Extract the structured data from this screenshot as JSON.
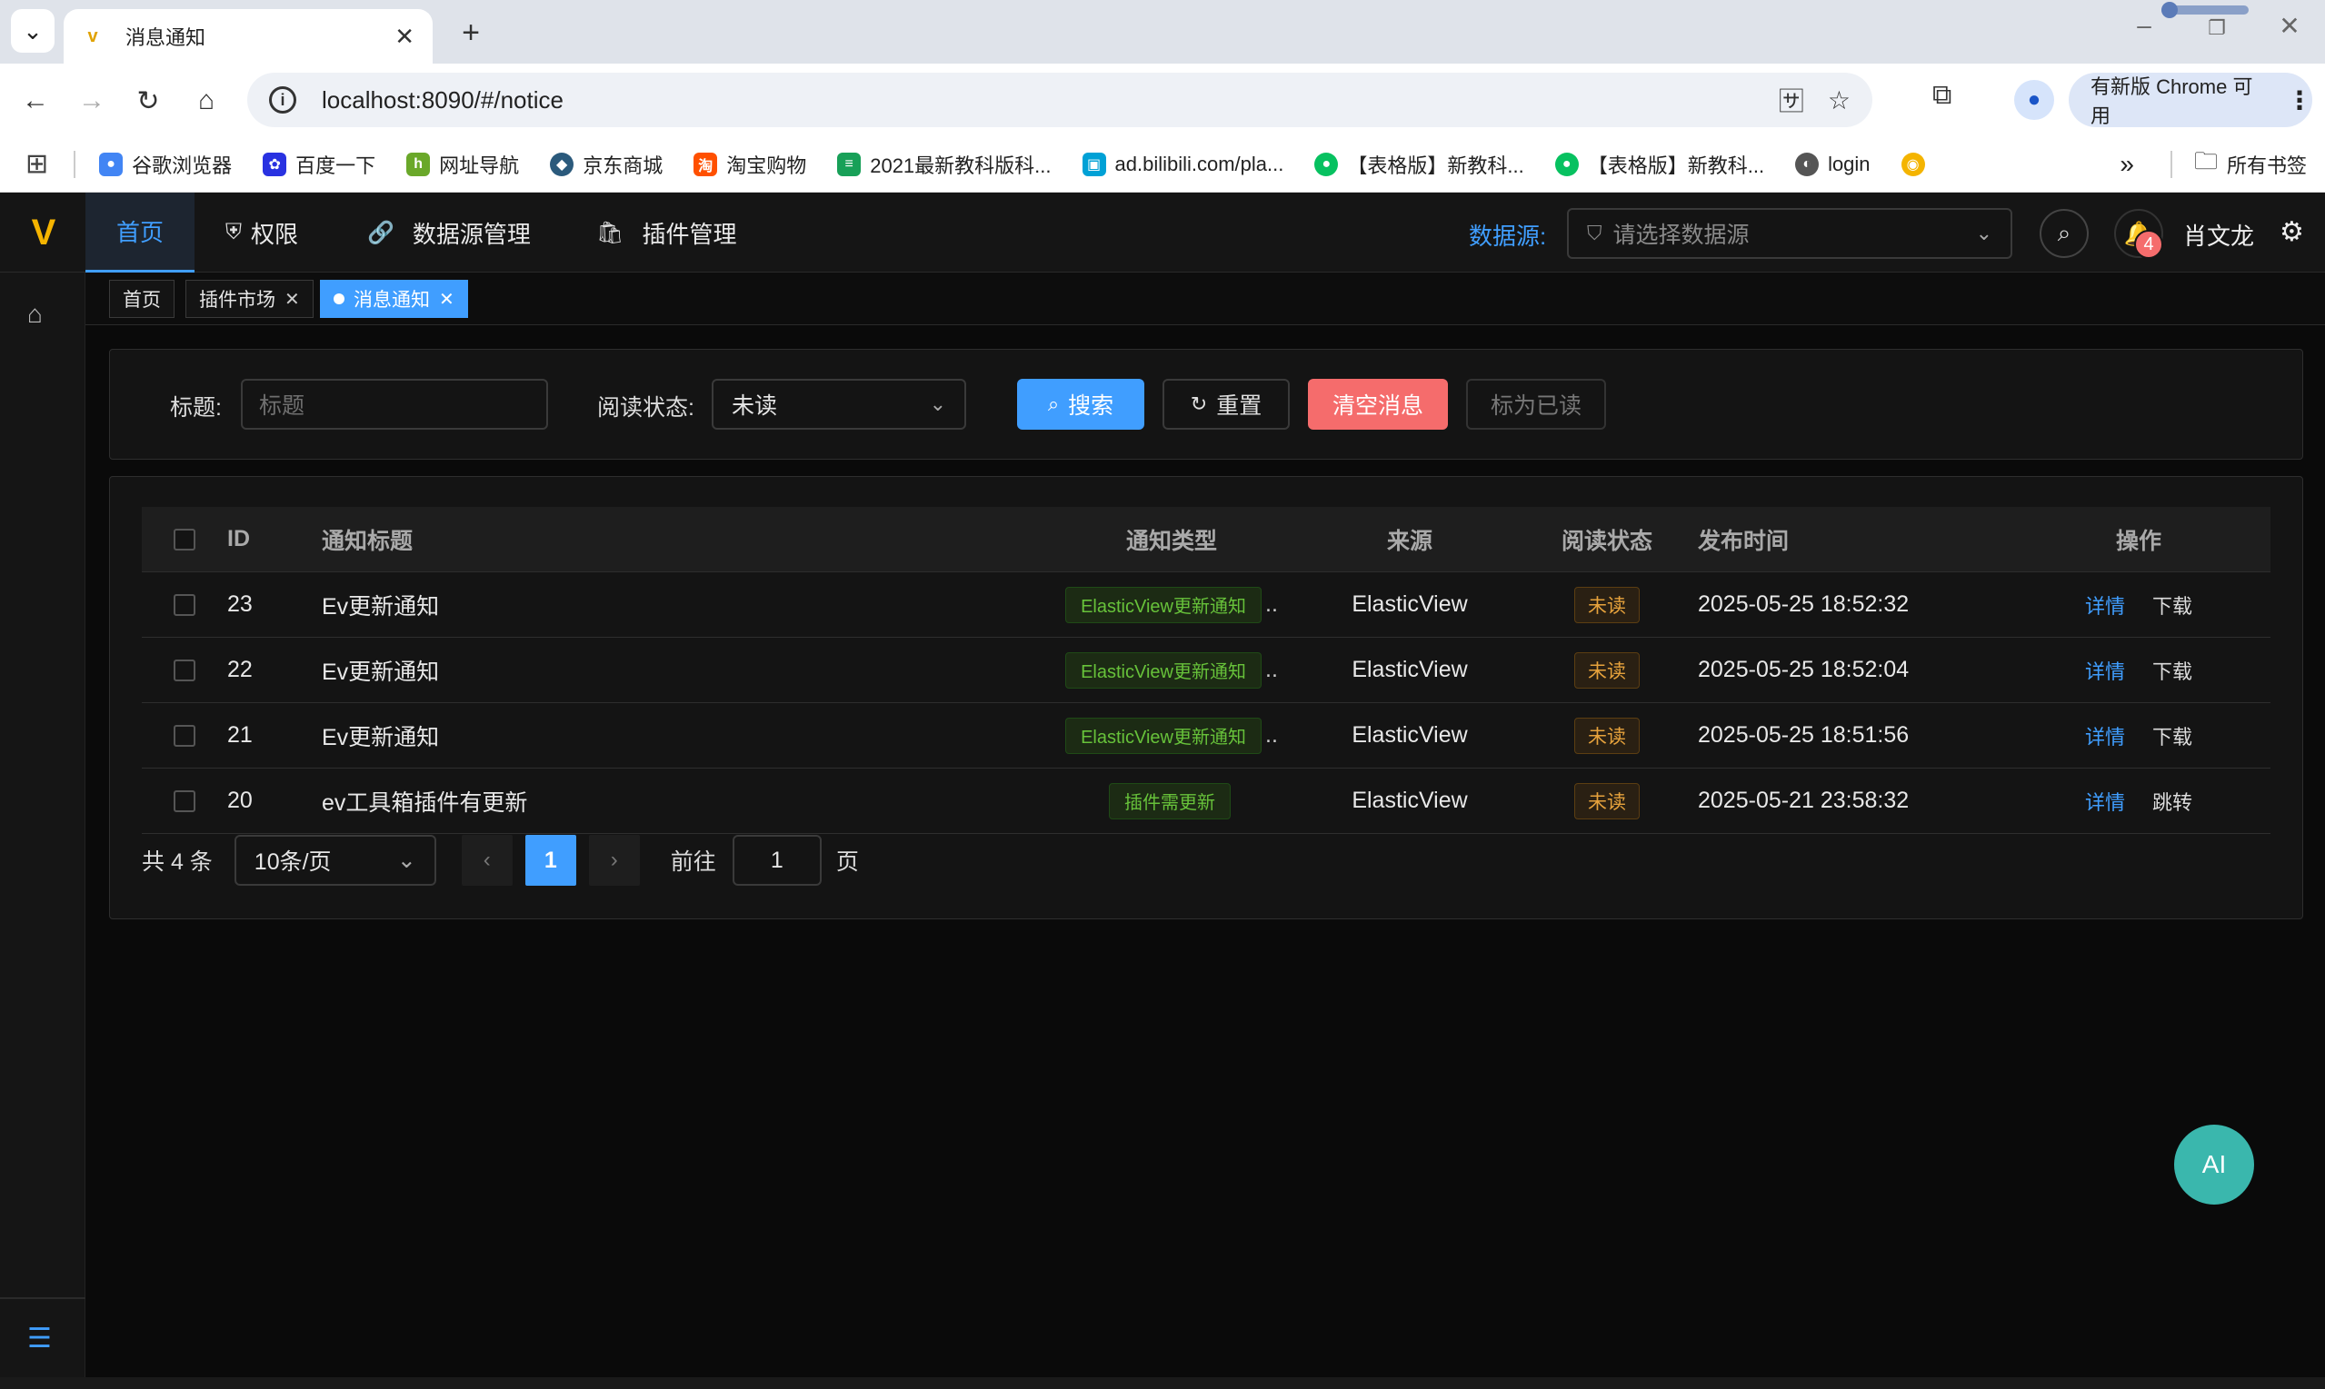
{
  "browser": {
    "tab_title": "消息通知",
    "tab_favicon": "v",
    "url": "localhost:8090/#/notice",
    "update_label": "有新版 Chrome 可用",
    "bookmarks": [
      {
        "label": "谷歌浏览器",
        "color": "#4285f4",
        "glyph": "●"
      },
      {
        "label": "百度一下",
        "color": "#2932e1",
        "glyph": "✿"
      },
      {
        "label": "网址导航",
        "color": "#6aa82a",
        "glyph": "h"
      },
      {
        "label": "京东商城",
        "color": "#2b5a7c",
        "glyph": "◆"
      },
      {
        "label": "淘宝购物",
        "color": "#ff5000",
        "glyph": "淘"
      },
      {
        "label": "2021最新教科版科...",
        "color": "#18a058",
        "glyph": "≡"
      },
      {
        "label": "ad.bilibili.com/pla...",
        "color": "#00a1d6",
        "glyph": "▣"
      },
      {
        "label": "【表格版】新教科...",
        "color": "#07c160",
        "glyph": "●"
      },
      {
        "label": "【表格版】新教科...",
        "color": "#07c160",
        "glyph": "●"
      },
      {
        "label": "login",
        "color": "#555555",
        "glyph": "◐"
      }
    ],
    "all_bookmarks": "所有书签"
  },
  "header": {
    "nav": [
      {
        "label": "首页",
        "icon": ""
      },
      {
        "label": "权限",
        "icon": "shield-icon"
      },
      {
        "label": "数据源管理",
        "icon": "link-icon"
      },
      {
        "label": "插件管理",
        "icon": "bag-icon"
      }
    ],
    "datasource_label": "数据源:",
    "datasource_placeholder": "请选择数据源",
    "notification_count": "4",
    "username": "肖文龙"
  },
  "tags": [
    {
      "label": "首页"
    },
    {
      "label": "插件市场"
    },
    {
      "label": "消息通知"
    }
  ],
  "filters": {
    "title_label": "标题:",
    "title_placeholder": "标题",
    "read_label": "阅读状态:",
    "read_value": "未读",
    "search_btn": "搜索",
    "reset_btn": "重置",
    "clear_btn": "清空消息",
    "mark_read_btn": "标为已读"
  },
  "table": {
    "headers": {
      "id": "ID",
      "title": "通知标题",
      "type": "通知类型",
      "source": "来源",
      "read": "阅读状态",
      "time": "发布时间",
      "op": "操作"
    },
    "rows": [
      {
        "id": "23",
        "title": "Ev更新通知",
        "type": "ElasticView更新通知",
        "truncated": "..",
        "source": "ElasticView",
        "read": "未读",
        "time": "2025-05-25 18:52:32",
        "op1": "详情",
        "op2": "下载"
      },
      {
        "id": "22",
        "title": "Ev更新通知",
        "type": "ElasticView更新通知",
        "truncated": "..",
        "source": "ElasticView",
        "read": "未读",
        "time": "2025-05-25 18:52:04",
        "op1": "详情",
        "op2": "下载"
      },
      {
        "id": "21",
        "title": "Ev更新通知",
        "type": "ElasticView更新通知",
        "truncated": "..",
        "source": "ElasticView",
        "read": "未读",
        "time": "2025-05-25 18:51:56",
        "op1": "详情",
        "op2": "下载"
      },
      {
        "id": "20",
        "title": "ev工具箱插件有更新",
        "type": "插件需更新",
        "truncated": "",
        "source": "ElasticView",
        "read": "未读",
        "time": "2025-05-21 23:58:32",
        "op1": "详情",
        "op2": "跳转"
      }
    ]
  },
  "pagination": {
    "total": "共 4 条",
    "page_size": "10条/页",
    "current": "1",
    "goto_label": "前往",
    "goto_value": "1",
    "page_suffix": "页"
  },
  "ai_button": "AI",
  "colors": {
    "primary": "#409eff",
    "danger": "#f56c6c",
    "success": "#67c23a",
    "warning": "#e6a23c",
    "ai": "#3ab7ad"
  }
}
